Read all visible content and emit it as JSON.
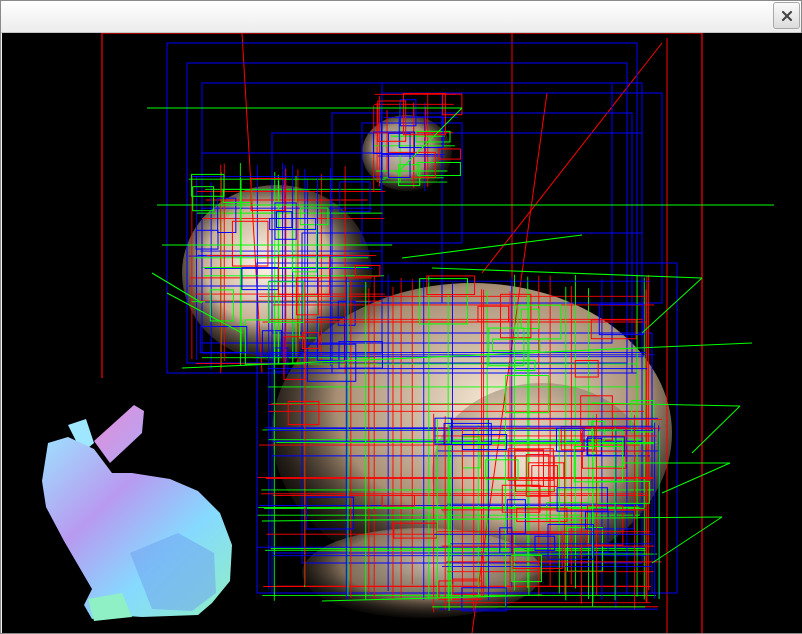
{
  "window": {
    "title": "",
    "close_icon": "close-icon"
  },
  "scene": {
    "content": "octree-wireframe-over-shaded-bunny",
    "inset": "normal-mapped-bunny",
    "colors": {
      "background": "#000000",
      "level1": "#ff0000",
      "level2": "#0000ff",
      "level3": "#00ff00",
      "bunny_shade": "#d8c7b0",
      "normal_a": "#7ad0ff",
      "normal_b": "#d98be6",
      "normal_c": "#89f2c8"
    }
  }
}
